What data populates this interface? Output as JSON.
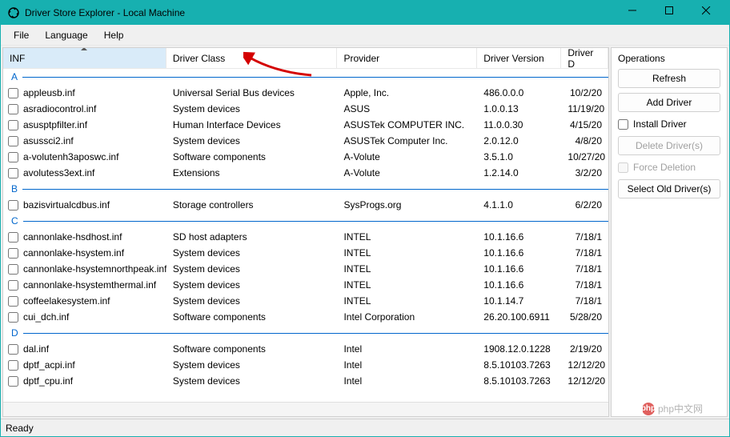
{
  "window": {
    "title": "Driver Store Explorer - Local Machine"
  },
  "menu": {
    "file": "File",
    "language": "Language",
    "help": "Help"
  },
  "columns": {
    "inf": "INF",
    "driver_class": "Driver Class",
    "provider": "Provider",
    "driver_version": "Driver Version",
    "driver_date": "Driver D"
  },
  "col_widths": {
    "inf": 210,
    "driver_class": 220,
    "provider": 180,
    "driver_version": 108,
    "driver_date": 60
  },
  "groups": [
    {
      "letter": "A",
      "rows": [
        {
          "inf": "appleusb.inf",
          "cls": "Universal Serial Bus devices",
          "prov": "Apple, Inc.",
          "ver": "486.0.0.0",
          "date": "10/2/20"
        },
        {
          "inf": "asradiocontrol.inf",
          "cls": "System devices",
          "prov": "ASUS",
          "ver": "1.0.0.13",
          "date": "11/19/20"
        },
        {
          "inf": "asusptpfilter.inf",
          "cls": "Human Interface Devices",
          "prov": "ASUSTek COMPUTER INC.",
          "ver": "11.0.0.30",
          "date": "4/15/20"
        },
        {
          "inf": "asussci2.inf",
          "cls": "System devices",
          "prov": "ASUSTek Computer Inc.",
          "ver": "2.0.12.0",
          "date": "4/8/20"
        },
        {
          "inf": "a-volutenh3aposwc.inf",
          "cls": "Software components",
          "prov": "A-Volute",
          "ver": "3.5.1.0",
          "date": "10/27/20"
        },
        {
          "inf": "avolutess3ext.inf",
          "cls": "Extensions",
          "prov": "A-Volute",
          "ver": "1.2.14.0",
          "date": "3/2/20"
        }
      ]
    },
    {
      "letter": "B",
      "rows": [
        {
          "inf": "bazisvirtualcdbus.inf",
          "cls": "Storage controllers",
          "prov": "SysProgs.org",
          "ver": "4.1.1.0",
          "date": "6/2/20"
        }
      ]
    },
    {
      "letter": "C",
      "rows": [
        {
          "inf": "cannonlake-hsdhost.inf",
          "cls": "SD host adapters",
          "prov": "INTEL",
          "ver": "10.1.16.6",
          "date": "7/18/1"
        },
        {
          "inf": "cannonlake-hsystem.inf",
          "cls": "System devices",
          "prov": "INTEL",
          "ver": "10.1.16.6",
          "date": "7/18/1"
        },
        {
          "inf": "cannonlake-hsystemnorthpeak.inf",
          "cls": "System devices",
          "prov": "INTEL",
          "ver": "10.1.16.6",
          "date": "7/18/1"
        },
        {
          "inf": "cannonlake-hsystemthermal.inf",
          "cls": "System devices",
          "prov": "INTEL",
          "ver": "10.1.16.6",
          "date": "7/18/1"
        },
        {
          "inf": "coffeelakesystem.inf",
          "cls": "System devices",
          "prov": "INTEL",
          "ver": "10.1.14.7",
          "date": "7/18/1"
        },
        {
          "inf": "cui_dch.inf",
          "cls": "Software components",
          "prov": "Intel Corporation",
          "ver": "26.20.100.6911",
          "date": "5/28/20"
        }
      ]
    },
    {
      "letter": "D",
      "rows": [
        {
          "inf": "dal.inf",
          "cls": "Software components",
          "prov": "Intel",
          "ver": "1908.12.0.1228",
          "date": "2/19/20"
        },
        {
          "inf": "dptf_acpi.inf",
          "cls": "System devices",
          "prov": "Intel",
          "ver": "8.5.10103.7263",
          "date": "12/12/20"
        },
        {
          "inf": "dptf_cpu.inf",
          "cls": "System devices",
          "prov": "Intel",
          "ver": "8.5.10103.7263",
          "date": "12/12/20"
        }
      ]
    }
  ],
  "operations": {
    "label": "Operations",
    "refresh": "Refresh",
    "add_driver": "Add Driver",
    "install_driver": "Install Driver",
    "delete_drivers": "Delete Driver(s)",
    "force_deletion": "Force Deletion",
    "select_old": "Select Old Driver(s)"
  },
  "status": {
    "ready": "Ready"
  },
  "watermark": {
    "text": "php中文网",
    "badge": "php"
  }
}
